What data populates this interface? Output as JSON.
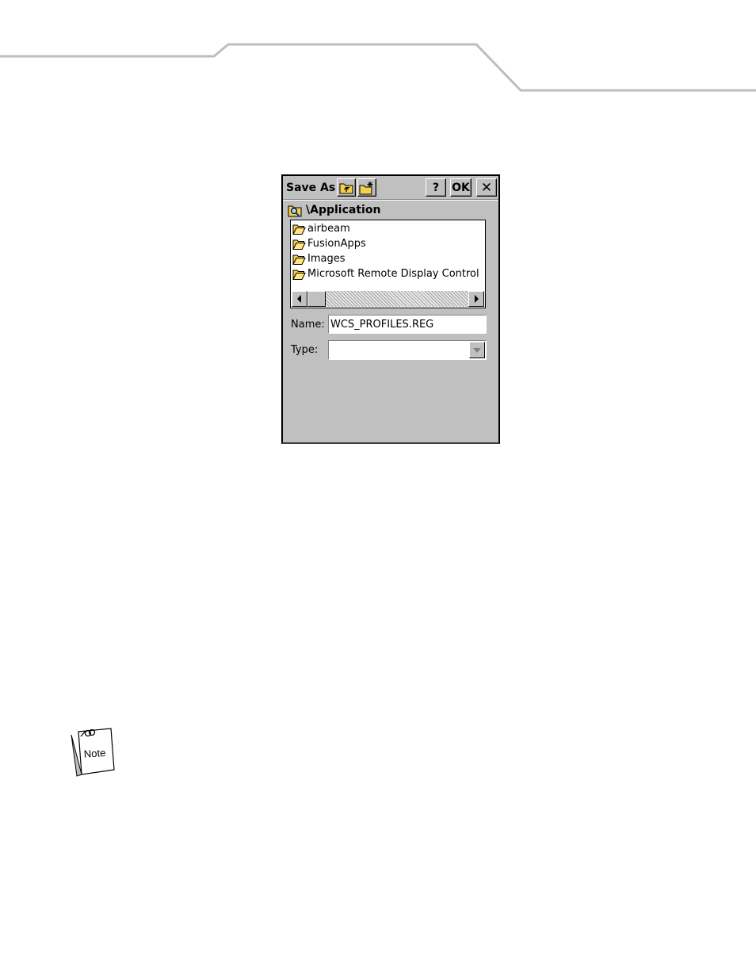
{
  "dialog": {
    "title": "Save As",
    "help_label": "?",
    "ok_label": "OK",
    "close_label": "✕",
    "current_path": "\\Application",
    "folders": [
      {
        "label": "airbeam"
      },
      {
        "label": "FusionApps"
      },
      {
        "label": "Images"
      },
      {
        "label": "Microsoft Remote Display Control"
      }
    ],
    "name_label": "Name:",
    "name_value": "WCS_PROFILES.REG",
    "type_label": "Type:",
    "type_value": ""
  },
  "note": {
    "label": "Note"
  },
  "colors": {
    "dialog_bg": "#c0c0c0",
    "folder_yellow": "#f5d04a",
    "header_line": "#bdbdbd"
  }
}
